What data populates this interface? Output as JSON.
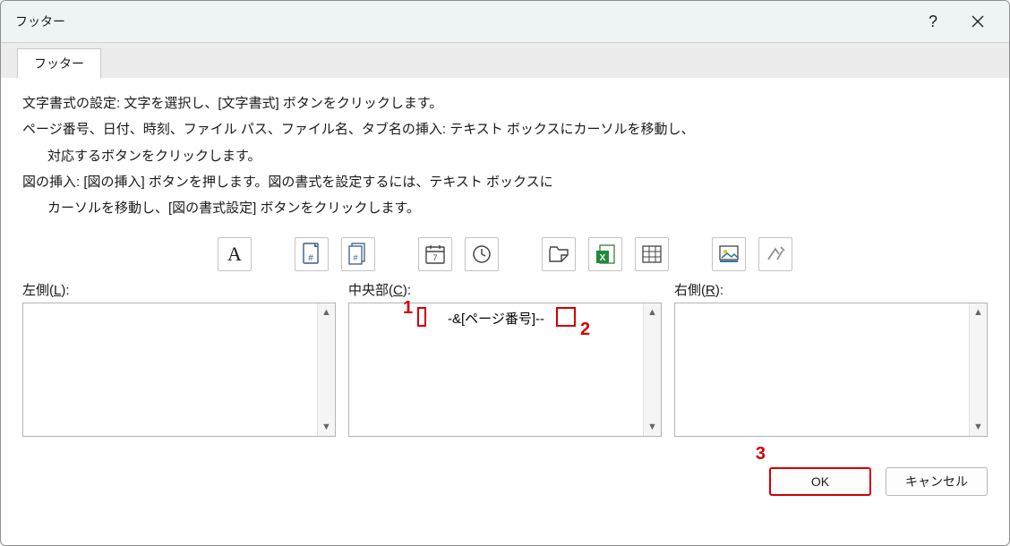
{
  "title": "フッター",
  "tabs": [
    {
      "label": "フッター"
    }
  ],
  "instructions": {
    "l1": "文字書式の設定: 文字を選択し、[文字書式] ボタンをクリックします。",
    "l2": "ページ番号、日付、時刻、ファイル パス、ファイル名、タブ名の挿入: テキスト ボックスにカーソルを移動し、",
    "l2b": "対応するボタンをクリックします。",
    "l3": "図の挿入: [図の挿入] ボタンを押します。図の書式を設定するには、テキスト ボックスに",
    "l3b": "カーソルを移動し、[図の書式設定] ボタンをクリックします。"
  },
  "toolbar": {
    "font": "A",
    "page_no": "page-number-icon",
    "pages_total": "pages-total-icon",
    "date": "date-icon",
    "time": "time-icon",
    "filepath": "filepath-icon",
    "workbook": "workbook-icon",
    "sheet": "sheet-icon",
    "picture": "picture-icon",
    "picfmt": "picture-format-icon"
  },
  "panes": {
    "left": {
      "label_pre": "左側(",
      "hotkey": "L",
      "label_post": "):",
      "value": ""
    },
    "center": {
      "label_pre": "中央部(",
      "hotkey": "C",
      "label_post": "):",
      "value": "-&[ページ番号]--"
    },
    "right": {
      "label_pre": "右側(",
      "hotkey": "R",
      "label_post": "):",
      "value": ""
    }
  },
  "buttons": {
    "ok": "OK",
    "cancel": "キャンセル"
  },
  "annotations": {
    "n1": "1",
    "n2": "2",
    "n3": "3"
  }
}
